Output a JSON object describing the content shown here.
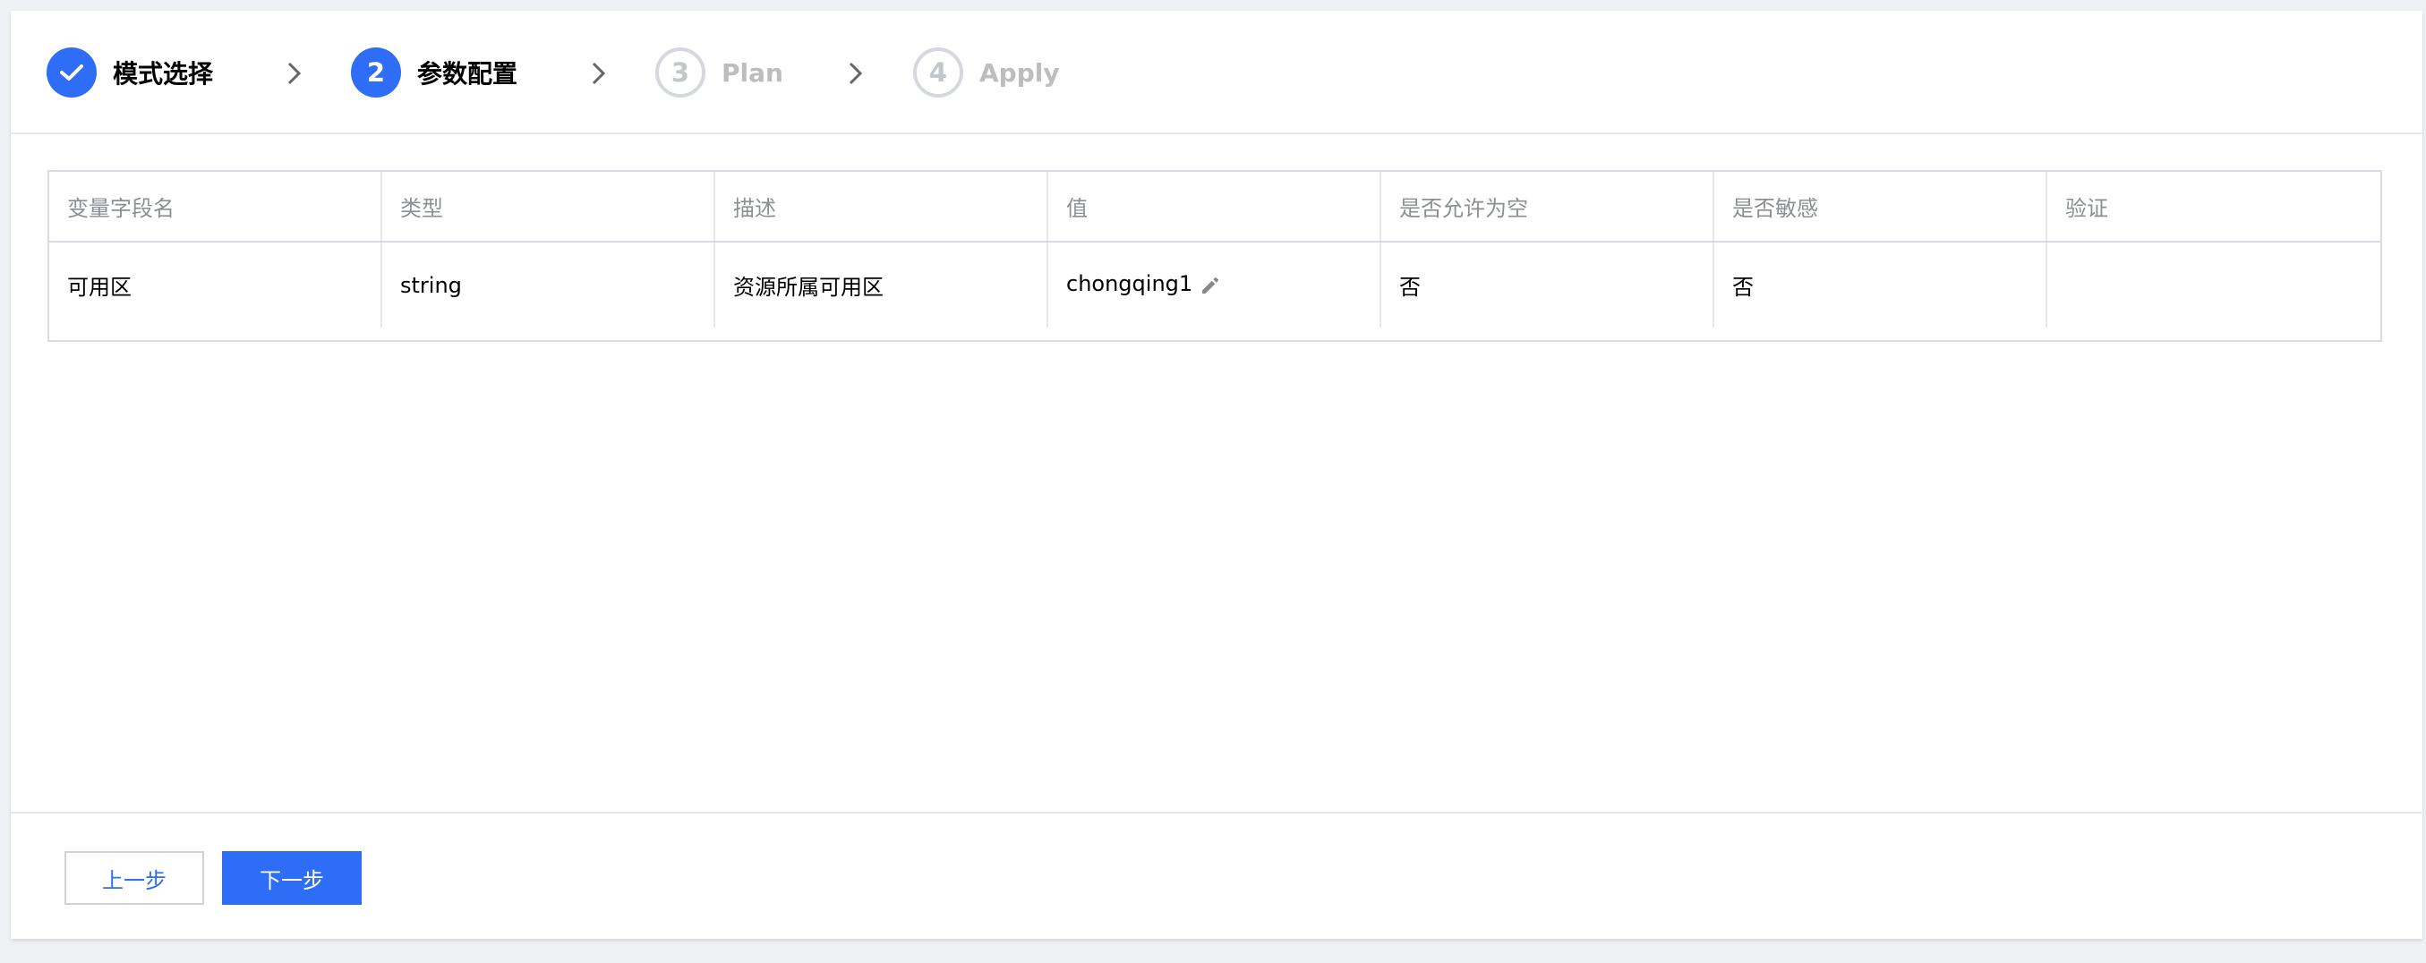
{
  "steps": [
    {
      "number": "",
      "label": "模式选择",
      "state": "done"
    },
    {
      "number": "2",
      "label": "参数配置",
      "state": "active"
    },
    {
      "number": "3",
      "label": "Plan",
      "state": "todo"
    },
    {
      "number": "4",
      "label": "Apply",
      "state": "todo"
    }
  ],
  "table": {
    "headers": [
      "变量字段名",
      "类型",
      "描述",
      "值",
      "是否允许为空",
      "是否敏感",
      "验证"
    ],
    "rows": [
      [
        "可用区",
        "string",
        "资源所属可用区",
        "chongqing1",
        "否",
        "否",
        ""
      ]
    ]
  },
  "footer": {
    "prev_label": "上一步",
    "next_label": "下一步"
  },
  "colors": {
    "primary": "#2e6df6",
    "muted": "#bdbdbd"
  }
}
